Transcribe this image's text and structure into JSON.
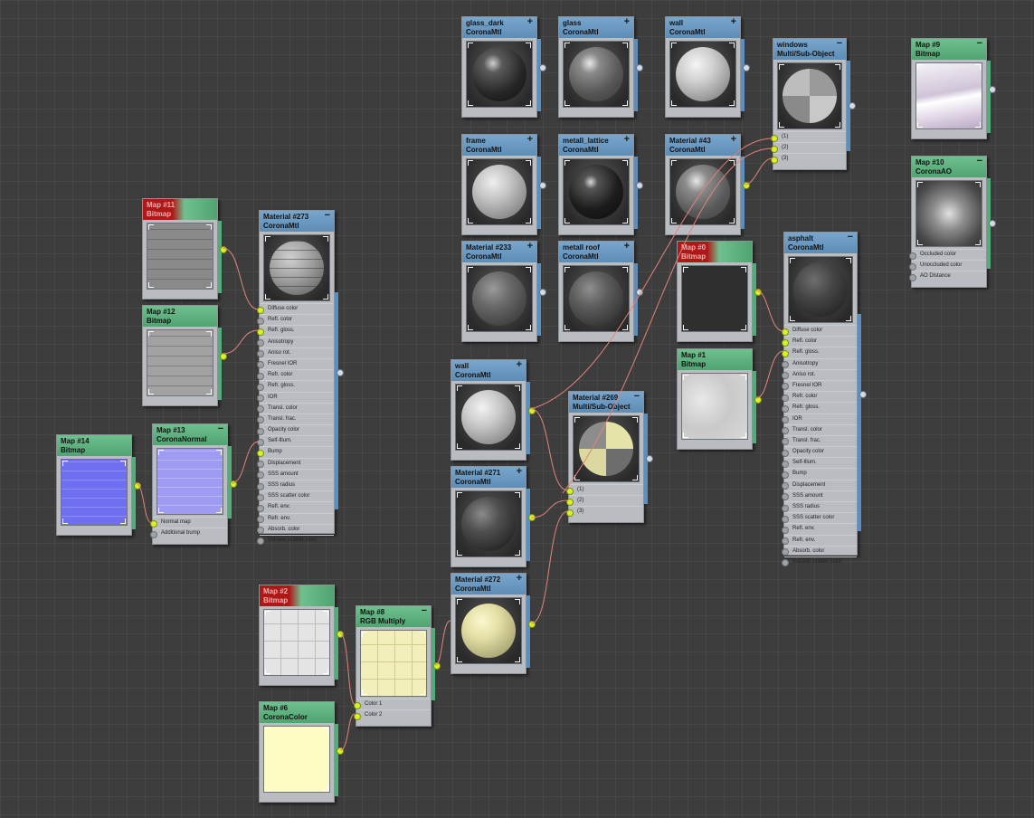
{
  "colors": {
    "material_header": "#6a99c2",
    "map_header": "#5fb27f",
    "error_header": "#b01818",
    "active_socket": "#d8f229",
    "wire": "#e2847a"
  },
  "materials": {
    "glass_dark": {
      "name": "glass_dark",
      "type": "CoronaMtl"
    },
    "glass": {
      "name": "glass",
      "type": "CoronaMtl"
    },
    "wall_top": {
      "name": "wall",
      "type": "CoronaMtl"
    },
    "windows": {
      "name": "windows",
      "type": "Multi/Sub-Object",
      "slots": [
        "(1)",
        "(2)",
        "(3)"
      ]
    },
    "frame": {
      "name": "frame",
      "type": "CoronaMtl"
    },
    "metall_lattice": {
      "name": "metall_lattice",
      "type": "CoronaMtl"
    },
    "mat43": {
      "name": "Material #43",
      "type": "CoronaMtl"
    },
    "mat233": {
      "name": "Material #233",
      "type": "CoronaMtl"
    },
    "metall_roof": {
      "name": "metall roof",
      "type": "CoronaMtl"
    },
    "asphalt": {
      "name": "asphalt",
      "type": "CoronaMtl"
    },
    "mat273": {
      "name": "Material #273",
      "type": "CoronaMtl"
    },
    "wall_mid": {
      "name": "wall",
      "type": "CoronaMtl"
    },
    "mat269": {
      "name": "Material #269",
      "type": "Multi/Sub-Object",
      "slots": [
        "(1)",
        "(2)",
        "(3)"
      ]
    },
    "mat271": {
      "name": "Material #271",
      "type": "CoronaMtl"
    },
    "mat272": {
      "name": "Material #272",
      "type": "CoronaMtl"
    }
  },
  "maps": {
    "map9": {
      "name": "Map #9",
      "type": "Bitmap"
    },
    "map10": {
      "name": "Map #10",
      "type": "CoronaAO",
      "slots": [
        "Occluded color",
        "Unoccluded color",
        "AO Distance"
      ]
    },
    "map11": {
      "name": "Map #11",
      "type": "Bitmap"
    },
    "map12": {
      "name": "Map #12",
      "type": "Bitmap"
    },
    "map14": {
      "name": "Map #14",
      "type": "Bitmap"
    },
    "map13": {
      "name": "Map #13",
      "type": "CoronaNormal",
      "slots": [
        "Normal map",
        "Additional bump"
      ]
    },
    "map_err": {
      "name": "Map #0",
      "type": "Bitmap"
    },
    "map1": {
      "name": "Map #1",
      "type": "Bitmap"
    },
    "map42": {
      "name": "Map #2",
      "type": "Bitmap"
    },
    "map8": {
      "name": "Map #8",
      "type": "RGB Multiply",
      "slots": [
        "Color 1",
        "Color 2"
      ]
    },
    "map6": {
      "name": "Map #6",
      "type": "CoronaColor"
    }
  },
  "corona_slots": [
    "Diffuse color",
    "Refl. color",
    "Refl. gloss.",
    "Anisotropy",
    "Aniso rot.",
    "Fresnel IOR",
    "Refr. color",
    "Refr. gloss.",
    "IOR",
    "Transl. color",
    "Transl. frac.",
    "Opacity color",
    "Self-Illum.",
    "Bump",
    "Displacement",
    "SSS amount",
    "SSS radius",
    "SSS scatter color",
    "Refl. env.",
    "Refr. env.",
    "Absorb. color",
    "Volume scatter color"
  ],
  "icons": {
    "expand": "plus-icon",
    "collapse": "minus-icon"
  }
}
